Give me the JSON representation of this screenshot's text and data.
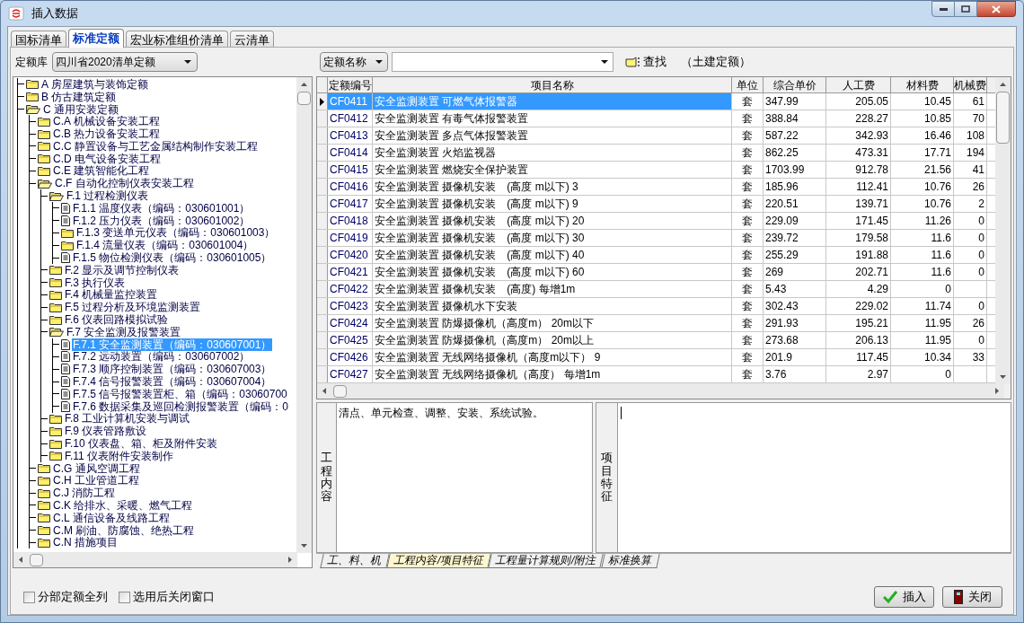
{
  "window": {
    "title": "插入数据"
  },
  "tabs": [
    {
      "label": "国标清单",
      "selected": false
    },
    {
      "label": "标准定额",
      "selected": true
    },
    {
      "label": "宏业标准组价清单",
      "selected": false
    },
    {
      "label": "云清单",
      "selected": false
    }
  ],
  "library": {
    "label": "定额库",
    "value": "四川省2020清单定额"
  },
  "tree": [
    {
      "label": "A 房屋建筑与装饰定额",
      "kind": "folder",
      "expanded": false,
      "selected": false
    },
    {
      "label": "B 仿古建筑定额",
      "kind": "folder",
      "expanded": false,
      "selected": false
    },
    {
      "label": "C 通用安装定额",
      "kind": "folder",
      "expanded": true,
      "selected": false,
      "children": [
        {
          "label": "C.A 机械设备安装工程",
          "kind": "folder",
          "expanded": false,
          "selected": false
        },
        {
          "label": "C.B 热力设备安装工程",
          "kind": "folder",
          "expanded": false,
          "selected": false
        },
        {
          "label": "C.C 静置设备与工艺金属结构制作安装工程",
          "kind": "folder",
          "expanded": false,
          "selected": false
        },
        {
          "label": "C.D 电气设备安装工程",
          "kind": "folder",
          "expanded": false,
          "selected": false
        },
        {
          "label": "C.E 建筑智能化工程",
          "kind": "folder",
          "expanded": false,
          "selected": false
        },
        {
          "label": "C.F 自动化控制仪表安装工程",
          "kind": "folder",
          "expanded": true,
          "selected": false,
          "children": [
            {
              "label": "F.1 过程检测仪表",
              "kind": "folder",
              "expanded": true,
              "selected": false,
              "children": [
                {
                  "label": "F.1.1 温度仪表（编码：030601001）",
                  "kind": "document",
                  "selected": false
                },
                {
                  "label": "F.1.2 压力仪表（编码：030601002）",
                  "kind": "document",
                  "selected": false
                },
                {
                  "label": "F.1.3 变送单元仪表（编码：030601003）",
                  "kind": "folder",
                  "expanded": false,
                  "selected": false
                },
                {
                  "label": "F.1.4 流量仪表（编码：030601004）",
                  "kind": "folder",
                  "expanded": false,
                  "selected": false
                },
                {
                  "label": "F.1.5 物位检测仪表（编码：030601005）",
                  "kind": "document",
                  "selected": false
                }
              ]
            },
            {
              "label": "F.2 显示及调节控制仪表",
              "kind": "folder",
              "expanded": false,
              "selected": false
            },
            {
              "label": "F.3 执行仪表",
              "kind": "folder",
              "expanded": false,
              "selected": false
            },
            {
              "label": "F.4 机械量监控装置",
              "kind": "folder",
              "expanded": false,
              "selected": false
            },
            {
              "label": "F.5 过程分析及环境监测装置",
              "kind": "folder",
              "expanded": false,
              "selected": false
            },
            {
              "label": "F.6 仪表回路模拟试验",
              "kind": "folder",
              "expanded": false,
              "selected": false
            },
            {
              "label": "F.7 安全监测及报警装置",
              "kind": "folder",
              "expanded": true,
              "selected": false,
              "children": [
                {
                  "label": "F.7.1 安全监测装置（编码：030607001）",
                  "kind": "document",
                  "selected": true
                },
                {
                  "label": "F.7.2 远动装置（编码：030607002）",
                  "kind": "document",
                  "selected": false
                },
                {
                  "label": "F.7.3 顺序控制装置（编码：030607003）",
                  "kind": "document",
                  "selected": false
                },
                {
                  "label": "F.7.4 信号报警装置（编码：030607004）",
                  "kind": "document",
                  "selected": false
                },
                {
                  "label": "F.7.5 信号报警装置柜、箱（编码：03060700",
                  "kind": "document",
                  "selected": false
                },
                {
                  "label": "F.7.6 数据采集及巡回检测报警装置（编码：0",
                  "kind": "document",
                  "selected": false
                }
              ]
            },
            {
              "label": "F.8 工业计算机安装与调试",
              "kind": "folder",
              "expanded": false,
              "selected": false
            },
            {
              "label": "F.9 仪表管路敷设",
              "kind": "folder",
              "expanded": false,
              "selected": false
            },
            {
              "label": "F.10 仪表盘、箱、柜及附件安装",
              "kind": "folder",
              "expanded": false,
              "selected": false
            },
            {
              "label": "F.11 仪表附件安装制作",
              "kind": "folder",
              "expanded": false,
              "selected": false
            }
          ]
        },
        {
          "label": "C.G 通风空调工程",
          "kind": "folder",
          "expanded": false,
          "selected": false
        },
        {
          "label": "C.H 工业管道工程",
          "kind": "folder",
          "expanded": false,
          "selected": false
        },
        {
          "label": "C.J 消防工程",
          "kind": "folder",
          "expanded": false,
          "selected": false
        },
        {
          "label": "C.K 给排水、采暖、燃气工程",
          "kind": "folder",
          "expanded": false,
          "selected": false
        },
        {
          "label": "C.L 通信设备及线路工程",
          "kind": "folder",
          "expanded": false,
          "selected": false
        },
        {
          "label": "C.M 刷油、防腐蚀、绝热工程",
          "kind": "folder",
          "expanded": false,
          "selected": false
        },
        {
          "label": "C.N 措施项目",
          "kind": "folder",
          "expanded": false,
          "selected": false
        }
      ]
    }
  ],
  "search": {
    "field": "定额名称",
    "find_button": "查找",
    "scope": "（土建定额）"
  },
  "table": {
    "columns": [
      "定额编号",
      "项目名称",
      "单位",
      "综合单价",
      "人工费",
      "材料费",
      "机械费"
    ],
    "rows": [
      {
        "cells": [
          "CF0411",
          "安全监测装置 可燃气体报警器",
          "套",
          "347.99",
          "205.05",
          "10.45",
          "61"
        ],
        "selected": true
      },
      {
        "cells": [
          "CF0412",
          "安全监测装置 有毒气体报警装置",
          "套",
          "388.84",
          "228.27",
          "10.85",
          "70"
        ],
        "selected": false
      },
      {
        "cells": [
          "CF0413",
          "安全监测装置 多点气体报警装置",
          "套",
          "587.22",
          "342.93",
          "16.46",
          "108"
        ],
        "selected": false
      },
      {
        "cells": [
          "CF0414",
          "安全监测装置 火焰监视器",
          "套",
          "862.25",
          "473.31",
          "17.71",
          "194"
        ],
        "selected": false
      },
      {
        "cells": [
          "CF0415",
          "安全监测装置 燃烧安全保护装置",
          "套",
          "1703.99",
          "912.78",
          "21.56",
          "41"
        ],
        "selected": false
      },
      {
        "cells": [
          "CF0416",
          "安全监测装置 摄像机安装　(高度 m以下) 3",
          "套",
          "185.96",
          "112.41",
          "10.76",
          "26"
        ],
        "selected": false
      },
      {
        "cells": [
          "CF0417",
          "安全监测装置 摄像机安装　(高度 m以下) 9",
          "套",
          "220.51",
          "139.71",
          "10.76",
          "2"
        ],
        "selected": false
      },
      {
        "cells": [
          "CF0418",
          "安全监测装置 摄像机安装　(高度 m以下) 20",
          "套",
          "229.09",
          "171.45",
          "11.26",
          "0"
        ],
        "selected": false
      },
      {
        "cells": [
          "CF0419",
          "安全监测装置 摄像机安装　(高度 m以下) 30",
          "套",
          "239.72",
          "179.58",
          "11.6",
          "0"
        ],
        "selected": false
      },
      {
        "cells": [
          "CF0420",
          "安全监测装置 摄像机安装　(高度 m以下) 40",
          "套",
          "255.29",
          "191.88",
          "11.6",
          "0"
        ],
        "selected": false
      },
      {
        "cells": [
          "CF0421",
          "安全监测装置 摄像机安装　(高度 m以下) 60",
          "套",
          "269",
          "202.71",
          "11.6",
          "0"
        ],
        "selected": false
      },
      {
        "cells": [
          "CF0422",
          "安全监测装置 摄像机安装　(高度) 每增1m",
          "套",
          "5.43",
          "4.29",
          "0",
          ""
        ],
        "selected": false
      },
      {
        "cells": [
          "CF0423",
          "安全监测装置 摄像机水下安装",
          "套",
          "302.43",
          "229.02",
          "11.74",
          "0"
        ],
        "selected": false
      },
      {
        "cells": [
          "CF0424",
          "安全监测装置 防爆摄像机（高度m） 20m以下",
          "套",
          "291.93",
          "195.21",
          "11.95",
          "26"
        ],
        "selected": false
      },
      {
        "cells": [
          "CF0425",
          "安全监测装置 防爆摄像机（高度m） 20m以上",
          "套",
          "273.68",
          "206.13",
          "11.95",
          "0"
        ],
        "selected": false
      },
      {
        "cells": [
          "CF0426",
          "安全监测装置 无线网络摄像机（高度m以下） 9",
          "套",
          "201.9",
          "117.45",
          "10.34",
          "33"
        ],
        "selected": false
      },
      {
        "cells": [
          "CF0427",
          "安全监测装置 无线网络摄像机（高度） 每增1m",
          "套",
          "3.76",
          "2.97",
          "0",
          ""
        ],
        "selected": false
      }
    ]
  },
  "work_content": {
    "label": "工程内容",
    "text": "清点、单元检查、调整、安装、系统试验。"
  },
  "features": {
    "label": "项目特征"
  },
  "detail_tabs": [
    {
      "label": "工、料、机",
      "selected": false
    },
    {
      "label": "工程内容/项目特征",
      "selected": true
    },
    {
      "label": "工程量计算规则/附注",
      "selected": false
    },
    {
      "label": "标准换算",
      "selected": false
    }
  ],
  "options": [
    {
      "label": "分部定额全列",
      "checked": false
    },
    {
      "label": "选用后关闭窗口",
      "checked": false
    }
  ],
  "buttons": [
    {
      "label": "插入",
      "kind": "insert"
    },
    {
      "label": "关闭",
      "kind": "close"
    }
  ]
}
